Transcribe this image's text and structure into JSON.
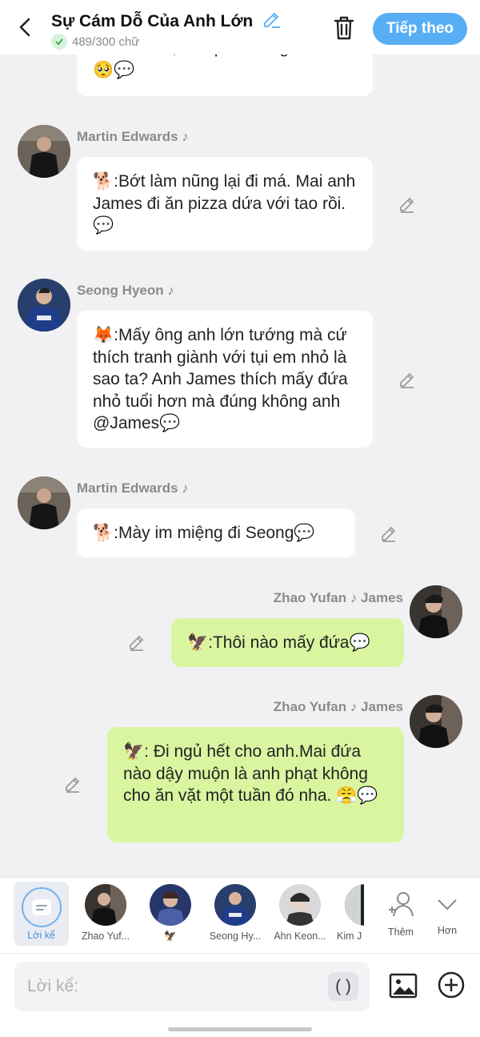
{
  "header": {
    "title": "Sự Cám Dỗ Của Anh Lớn",
    "count": "489/300 chữ",
    "next_label": "Tiếp theo"
  },
  "messages": [
    {
      "text": "nhất nhóm, anh phải cưng em chứ🥺💬"
    },
    {
      "sender": "Martin Edwards ♪",
      "text": "🐕:Bớt làm nũng lại đi má. Mai anh James đi ăn pizza dứa với tao rồi.💬"
    },
    {
      "sender": "Seong Hyeon ♪",
      "text": "🦊:Mấy ông anh lớn tướng mà cứ thích tranh giành với tụi em nhỏ là sao ta? Anh James thích mấy đứa nhỏ tuổi hơn mà đúng không anh @James💬"
    },
    {
      "sender": "Martin Edwards ♪",
      "text": "🐕:Mày im miệng đi Seong💬"
    },
    {
      "sender": "Zhao Yufan ♪ James",
      "text": "🦅:Thôi nào mấy đứa💬"
    },
    {
      "sender": "Zhao Yufan ♪ James",
      "text": "🦅: Đi ngủ hết cho anh.Mai đứa nào dậy muộn là anh phạt không cho ăn vặt một tuần đó nha. 😤💬"
    }
  ],
  "characters": {
    "narration": "Lời kể",
    "items": [
      "Zhao Yuf...",
      "🦅",
      "Seong Hy...",
      "Ahn Keon...",
      "Kim J"
    ],
    "more": "Thêm",
    "collapse": "Hơn"
  },
  "input": {
    "placeholder": "Lời kể:",
    "paren": "( )"
  },
  "colors": {
    "accent": "#58aef5",
    "my_bubble": "#d9f5a0",
    "other_bubble": "#ffffff",
    "background": "#f1f1f3"
  }
}
